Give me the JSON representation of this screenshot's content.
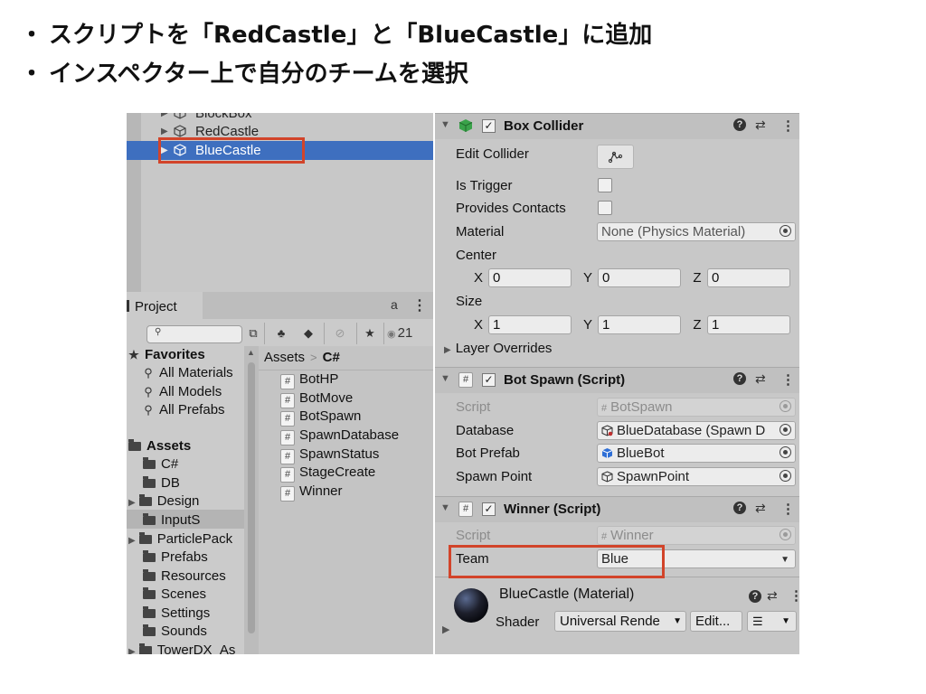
{
  "headings": {
    "line1": "スクリプトを「RedCastle」と「BlueCastle」に追加",
    "line2": "インスペクター上で自分のチームを選択",
    "bullet": "・"
  },
  "hierarchy": {
    "items": [
      "BlockBox",
      "RedCastle",
      "BlueCastle"
    ],
    "selected": "BlueCastle",
    "highlight_color": "#3e6fbf"
  },
  "project": {
    "tab_label": "Project",
    "search_placeholder": "",
    "hidden_count": "21",
    "favorites_label": "Favorites",
    "favorites": [
      "All Materials",
      "All Models",
      "All Prefabs"
    ],
    "assets_label": "Assets",
    "folders": [
      "C#",
      "DB",
      "Design",
      "InputS",
      "ParticlePack",
      "Prefabs",
      "Resources",
      "Scenes",
      "Settings",
      "Sounds",
      "TowerDX_As"
    ],
    "selected_folder": "C#",
    "breadcrumb_root": "Assets",
    "breadcrumb_current": "C#",
    "scripts": [
      "BotHP",
      "BotMove",
      "BotSpawn",
      "SpawnDatabase",
      "SpawnStatus",
      "StageCreate",
      "Winner"
    ]
  },
  "inspector": {
    "box_collider": {
      "title": "Box Collider",
      "edit_collider_label": "Edit Collider",
      "is_trigger_label": "Is Trigger",
      "provides_contacts_label": "Provides Contacts",
      "material_label": "Material",
      "material_value": "None (Physics Material)",
      "center_label": "Center",
      "center": {
        "x": "0",
        "y": "0",
        "z": "0"
      },
      "size_label": "Size",
      "size": {
        "x": "1",
        "y": "1",
        "z": "1"
      },
      "layer_overrides_label": "Layer Overrides",
      "axis_x": "X",
      "axis_y": "Y",
      "axis_z": "Z"
    },
    "bot_spawn": {
      "title": "Bot Spawn (Script)",
      "script_label": "Script",
      "script_value": "BotSpawn",
      "database_label": "Database",
      "database_value": "BlueDatabase (Spawn D",
      "bot_prefab_label": "Bot Prefab",
      "bot_prefab_value": "BlueBot",
      "spawn_point_label": "Spawn Point",
      "spawn_point_value": "SpawnPoint"
    },
    "winner": {
      "title": "Winner (Script)",
      "script_label": "Script",
      "script_value": "Winner",
      "team_label": "Team",
      "team_value": "Blue"
    },
    "material": {
      "title": "BlueCastle (Material)",
      "shader_label": "Shader",
      "shader_value": "Universal Rende",
      "edit_label": "Edit..."
    }
  },
  "colors": {
    "annotation_red": "#d2442a"
  }
}
